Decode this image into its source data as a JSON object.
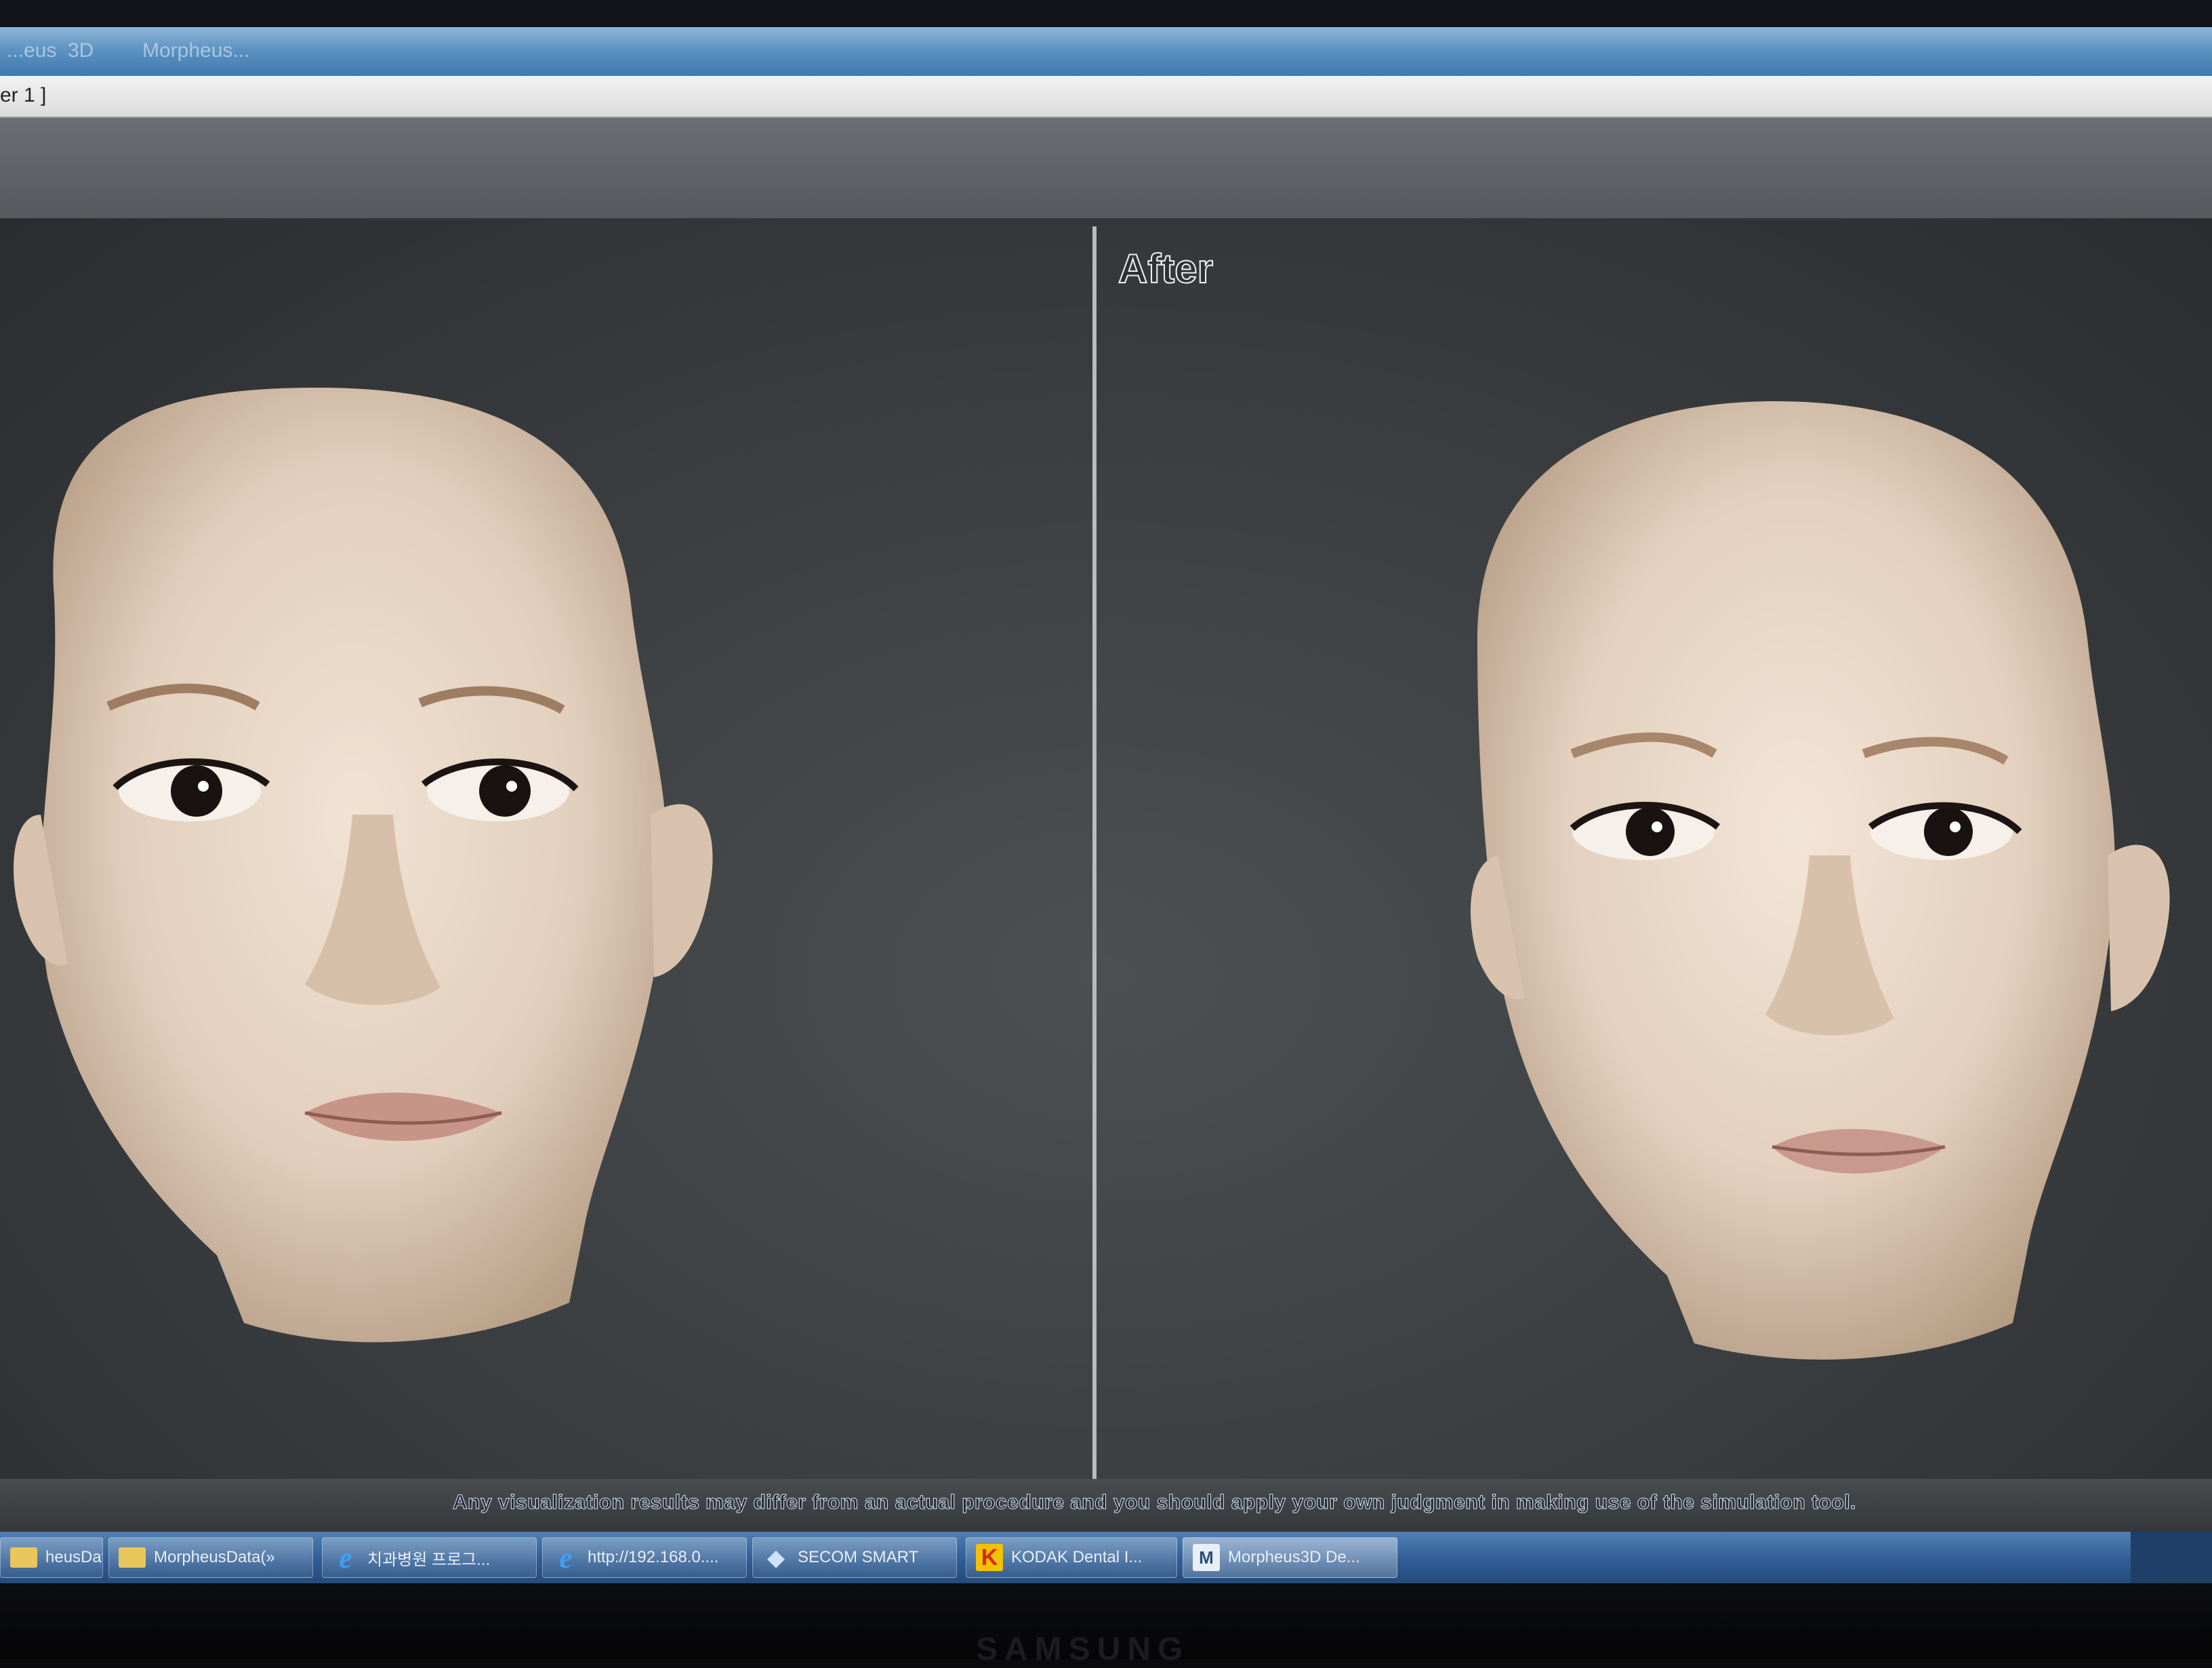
{
  "window": {
    "title_fragments": [
      "...eus",
      "3D",
      "Morpheus..."
    ],
    "tab_label": "er 1 ]"
  },
  "viewport": {
    "after_label": "After",
    "disclaimer": "Any visualization results may differ from an actual procedure and you should apply your own judgment in making use of the simulation tool."
  },
  "taskbar": {
    "items": [
      {
        "label": "heusData(»",
        "icon": "folder-icon"
      },
      {
        "label": "MorpheusData(»",
        "icon": "folder-icon"
      },
      {
        "label": "치과병원 프로그...",
        "icon": "ie-icon"
      },
      {
        "label": "http://192.168.0....",
        "icon": "ie-icon"
      },
      {
        "label": "SECOM SMART",
        "icon": "secom-icon"
      },
      {
        "label": "KODAK Dental I...",
        "icon": "kodak-icon"
      },
      {
        "label": "Morpheus3D De...",
        "icon": "morpheus-icon"
      }
    ]
  },
  "monitor": {
    "brand": "SAMSUNG"
  }
}
